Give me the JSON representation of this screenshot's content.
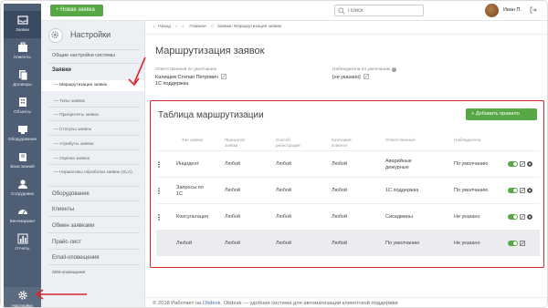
{
  "colors": {
    "rail": "#4d5e75",
    "accent_green": "#57a845",
    "highlight_red": "#d9262a",
    "link_blue": "#4a77b4"
  },
  "rail": {
    "items": [
      {
        "label": "Заявки",
        "icon": "tickets-icon"
      },
      {
        "label": "Клиенты",
        "icon": "clients-icon"
      },
      {
        "label": "Договоры",
        "icon": "contracts-icon"
      },
      {
        "label": "Объекты",
        "icon": "objects-icon"
      },
      {
        "label": "Оборудование",
        "icon": "equipment-icon"
      },
      {
        "label": "База знаний",
        "icon": "knowledge-base-icon"
      },
      {
        "label": "Сотрудники",
        "icon": "employees-icon"
      },
      {
        "label": "Бенчмаркинг",
        "icon": "benchmark-icon"
      },
      {
        "label": "Отчеты",
        "icon": "reports-icon"
      }
    ],
    "settings_label": "Настройки"
  },
  "topbar": {
    "new_ticket": "+ Новая заявка",
    "search_placeholder": "Поиск",
    "user_name": "Иван П."
  },
  "subnav": {
    "title": "Настройки",
    "items": [
      {
        "label": "Общие настройки системы"
      },
      {
        "label": "Заявки"
      },
      {
        "label": "— Маршрутизация заявок"
      },
      {
        "label": "— Типы заявок"
      },
      {
        "label": "— Приоритеты заявок"
      },
      {
        "label": "— Статусы заявок"
      },
      {
        "label": "— Атрибуты заявок"
      },
      {
        "label": "— Оценка заявок"
      },
      {
        "label": "— Нормативы обработки заявок (SLA)"
      },
      {
        "label": "Оборудование"
      },
      {
        "label": "Клиенты"
      },
      {
        "label": "Обмен заявками"
      },
      {
        "label": "Прайс-лист"
      },
      {
        "label": "Email-оповещения"
      },
      {
        "label": "SMS-оповещения"
      }
    ]
  },
  "breadcrumbs": {
    "back": "← Назад",
    "home": "Главная",
    "sep": "›",
    "current": "Заявки: Маршрутизация заявок"
  },
  "page": {
    "title": "Маршрутизация заявок",
    "default_assignee_label": "Ответственный по умолчанию",
    "default_assignee_name": "Калищев Степан Петрович",
    "default_assignee_group": "1С поддержка",
    "default_watchers_label": "Наблюдатели по умолчанию",
    "default_watchers_value": "[не указано]"
  },
  "routing": {
    "title": "Таблица маршрутизации",
    "add_button": "+ Добавить правило",
    "columns": [
      "Тип заявок",
      "Приоритет заявки",
      "Способ регистрации",
      "Категория клиента",
      "Ответственный",
      "Наблюдатели"
    ],
    "rows": [
      {
        "cells": [
          "Инцидент",
          "Любой",
          "Любой",
          "Любой",
          "Аварийные дежурные",
          "По умолчанию"
        ],
        "draggable": true,
        "deletable": true,
        "default": false
      },
      {
        "cells": [
          "Запросы по 1С",
          "Любой",
          "Любой",
          "Любой",
          "1С поддержка",
          "По умолчанию"
        ],
        "draggable": true,
        "deletable": true,
        "default": false
      },
      {
        "cells": [
          "Консультация",
          "Любой",
          "Любой",
          "Любой",
          "Сисадмины",
          "Не указано"
        ],
        "draggable": true,
        "deletable": true,
        "default": false
      },
      {
        "cells": [
          "Любой",
          "Любой",
          "Любой",
          "Любой",
          "По умолчанию",
          "Не указано"
        ],
        "draggable": false,
        "deletable": false,
        "default": true
      }
    ]
  },
  "footer": {
    "year": "© 2018",
    "text_a": "Работает на",
    "brand": "Okdesk",
    "text_b": ". Okdesk — удобная система для автоматизации клиентской поддержки"
  }
}
